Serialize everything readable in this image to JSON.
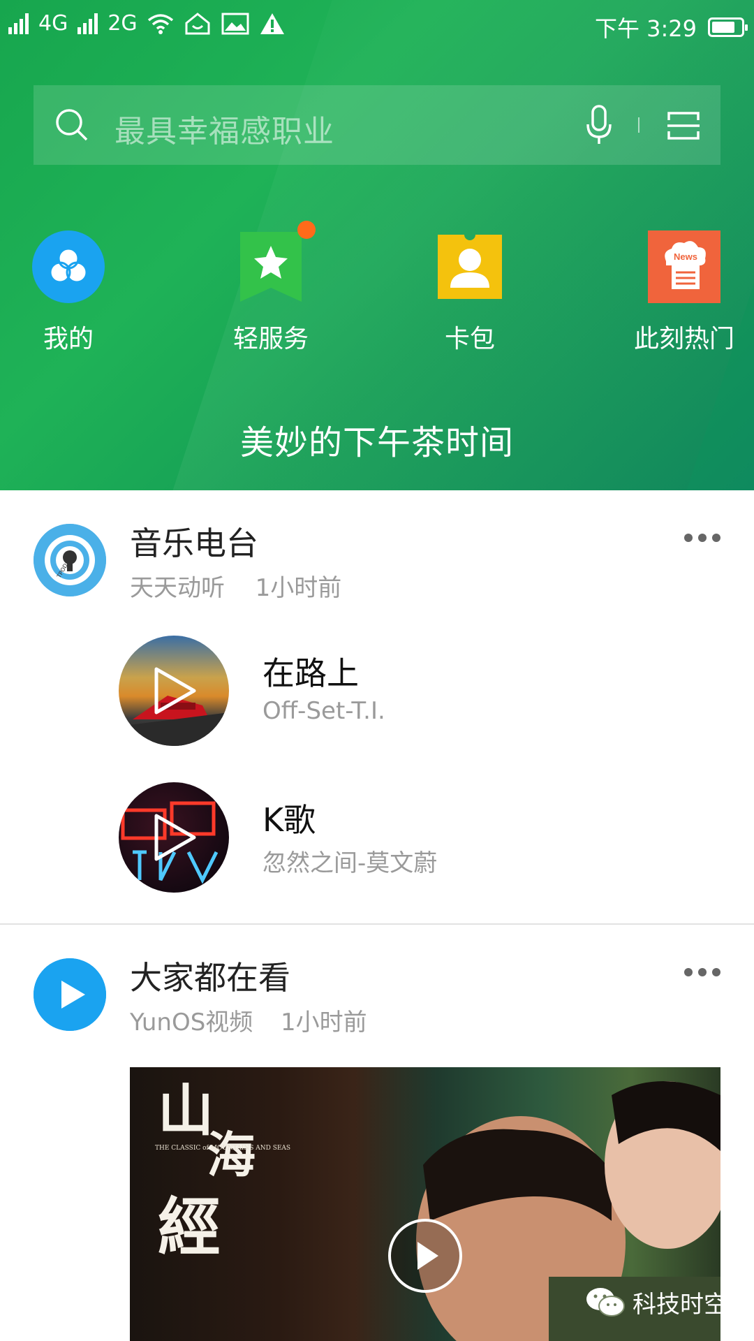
{
  "status_bar": {
    "network1": "4G",
    "network2": "2G",
    "sim2_label": "2",
    "sim1_label": "1",
    "time": "下午 3:29"
  },
  "search": {
    "placeholder": "最具幸福感职业"
  },
  "shortcuts": [
    {
      "label": "我的",
      "icon": "my-icon",
      "color": "#1aa3f0"
    },
    {
      "label": "轻服务",
      "icon": "star-bookmark-icon",
      "color": "#33c24a"
    },
    {
      "label": "卡包",
      "icon": "card-wallet-icon",
      "color": "#f4c20d"
    },
    {
      "label": "此刻热门",
      "icon": "news-icon",
      "color": "#f0643c",
      "icon_text": "News"
    }
  ],
  "banner_text": "美妙的下午茶时间",
  "music_card": {
    "title": "音乐电台",
    "source": "天天动听",
    "time": "1小时前",
    "avatar_text": "TPOD",
    "tracks": [
      {
        "title": "在路上",
        "artist": "Off-Set-T.I."
      },
      {
        "title": "K歌",
        "artist": "忽然之间-莫文蔚"
      }
    ]
  },
  "video_card": {
    "title": "大家都在看",
    "source": "YunOS视频",
    "time": "1小时前",
    "poster_title": "山海經",
    "poster_sub": "THE CLASSIC of MOUNTAINS AND SEAS"
  },
  "watermark": "科技时空",
  "colors": {
    "header_green": "#1cac52",
    "accent_blue": "#1aa3f0",
    "badge_orange": "#ff6a1a"
  }
}
